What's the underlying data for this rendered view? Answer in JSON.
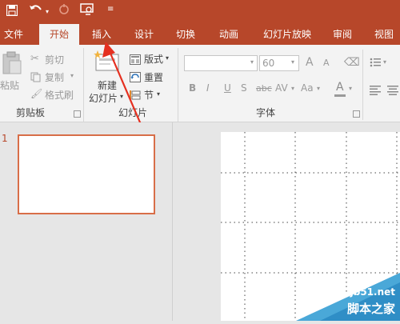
{
  "quick_access": {
    "save_icon": "save-icon",
    "undo_icon": "undo-icon",
    "redo_icon": "redo-icon",
    "present_icon": "present-from-start-icon",
    "customize_icon": "customize-quick-access-icon"
  },
  "tabs": [
    "文件",
    "开始",
    "插入",
    "设计",
    "切换",
    "动画",
    "幻灯片放映",
    "审阅",
    "视图"
  ],
  "active_tab": "开始",
  "ribbon": {
    "clipboard": {
      "paste_label": "粘贴",
      "cut_label": "剪切",
      "copy_label": "复制",
      "format_painter_label": "格式刷",
      "group_label": "剪贴板"
    },
    "slides": {
      "new_slide_label_1": "新建",
      "new_slide_label_2": "幻灯片",
      "layout_label": "版式",
      "reset_label": "重置",
      "section_label": "节",
      "group_label": "幻灯片"
    },
    "font": {
      "font_name_value": "",
      "font_size_value": "60",
      "bold": "B",
      "italic": "I",
      "underline": "U",
      "shadow": "S",
      "strikethrough": "abc",
      "spacing": "AV",
      "change_case": "Aa",
      "color": "A",
      "grow": "A",
      "shrink": "A",
      "group_label": "字体"
    }
  },
  "slide_panel": {
    "slide_number": "1"
  },
  "watermark": {
    "site": "jb51.net",
    "name": "脚本之家"
  },
  "colors": {
    "brand": "#b7472a",
    "thumb_border": "#d86e48"
  }
}
